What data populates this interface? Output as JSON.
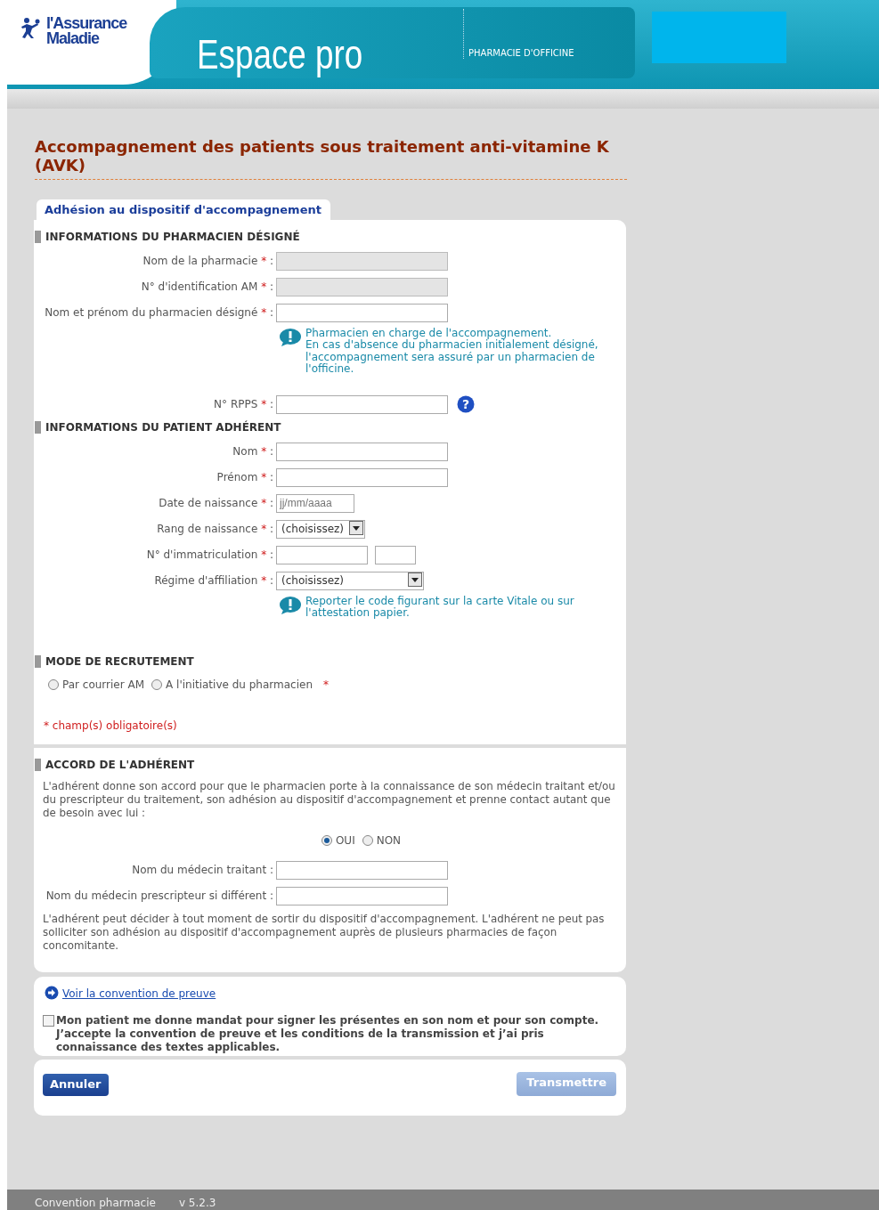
{
  "header": {
    "logo_line1": "l'Assurance",
    "logo_line2": "Maladie",
    "title": "Espace pro",
    "subtitle": "PHARMACIE D'OFFICINE"
  },
  "page_title": "Accompagnement des patients sous traitement anti-vitamine K (AVK)",
  "tab": {
    "label": "Adhésion au dispositif d'accompagnement",
    "selected": true
  },
  "required_mark": "*",
  "label_suffix": ":",
  "sections": [
    {
      "heading": "INFORMATIONS DU PHARMACIEN DÉSIGNÉ",
      "rows": [
        {
          "kind": "field",
          "label": "Nom de la pharmacie",
          "required": true,
          "disabled": true
        },
        {
          "kind": "field",
          "label": "N° d'identification AM",
          "required": true,
          "disabled": true
        },
        {
          "kind": "field",
          "label": "Nom et prénom du pharmacien désigné",
          "required": true,
          "disabled": false
        },
        {
          "kind": "info",
          "lines": [
            "Pharmacien en charge de l'accompagnement.",
            "En cas d'absence du pharmacien initialement désigné, l'accompagnement sera assuré par un pharmacien de l'officine."
          ]
        },
        {
          "kind": "field",
          "label": "N° RPPS",
          "required": true,
          "disabled": false,
          "help": "?"
        }
      ]
    },
    {
      "heading": "INFORMATIONS DU PATIENT ADHÉRENT",
      "rows": [
        {
          "kind": "field",
          "label": "Nom",
          "required": true,
          "disabled": false
        },
        {
          "kind": "field",
          "label": "Prénom",
          "required": true,
          "disabled": false
        },
        {
          "kind": "date",
          "label": "Date de naissance",
          "required": true,
          "placeholder": "jj/mm/aaaa"
        },
        {
          "kind": "select",
          "label": "Rang de naissance",
          "required": true,
          "value": "(choisissez)",
          "wide": false
        },
        {
          "kind": "pair",
          "label": "N° d'immatriculation",
          "required": true
        },
        {
          "kind": "select",
          "label": "Régime d'affiliation",
          "required": true,
          "value": "(choisissez)",
          "wide": true
        },
        {
          "kind": "info",
          "lines": [
            "Reporter le code figurant sur la carte Vitale ou sur l'attestation papier."
          ]
        }
      ]
    },
    {
      "heading": "MODE DE RECRUTEMENT",
      "rows": [
        {
          "kind": "radios",
          "required": true,
          "options": [
            {
              "label": "Par courrier AM",
              "selected": false
            },
            {
              "label": "A l'initiative du pharmacien",
              "selected": false
            }
          ]
        },
        {
          "kind": "note",
          "text": "* champ(s) obligatoire(s)"
        }
      ]
    },
    {
      "heading": "ACCORD DE L'ADHÉRENT",
      "panel_break": true,
      "rows": [
        {
          "kind": "paragraph",
          "text": "L'adhérent donne son accord pour que le pharmacien porte à la connaissance de son médecin traitant et/ou du prescripteur du traitement, son adhésion au dispositif d'accompagnement et prenne contact autant que de besoin avec lui :"
        },
        {
          "kind": "choice",
          "required": false,
          "options": [
            {
              "label": "OUI",
              "selected": true
            },
            {
              "label": "NON",
              "selected": false
            }
          ]
        },
        {
          "kind": "field",
          "label": "Nom du médecin traitant",
          "required": false,
          "disabled": false
        },
        {
          "kind": "field",
          "label": "Nom du médecin prescripteur si différent",
          "required": false,
          "disabled": false
        },
        {
          "kind": "paragraph",
          "text": "L'adhérent peut décider à tout moment de sortir du dispositif d'accompagnement. L'adhérent ne peut pas solliciter son adhésion au dispositif d'accompagnement auprès de plusieurs pharmacies de façon concomitante."
        }
      ]
    }
  ],
  "convention_link": "Voir la convention de preuve",
  "mandate": {
    "checked": false,
    "text": "Mon patient me donne mandat pour signer les présentes en son nom et pour son compte. J’accepte la convention de preuve et les conditions de la transmission et j’ai pris connaissance des textes applicables."
  },
  "buttons": [
    {
      "label": "Annuler",
      "disabled": false
    },
    {
      "label": "Transmettre",
      "disabled": true
    }
  ],
  "footer": {
    "app": "Convention pharmacie",
    "version": "v 5.2.3"
  }
}
